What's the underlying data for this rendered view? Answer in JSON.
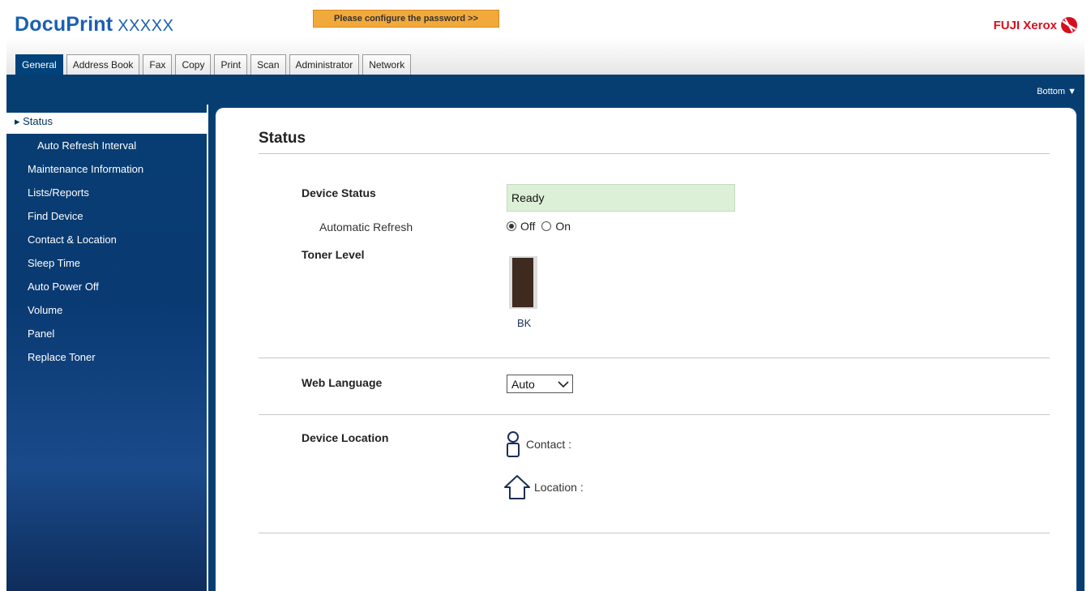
{
  "header": {
    "logo_main": "DocuPrint",
    "logo_model": "XXXXX",
    "password_button": "Please configure the password >>",
    "brand": "FUJI Xerox"
  },
  "tabs": [
    {
      "label": "General",
      "active": true
    },
    {
      "label": "Address Book"
    },
    {
      "label": "Fax"
    },
    {
      "label": "Copy"
    },
    {
      "label": "Print"
    },
    {
      "label": "Scan"
    },
    {
      "label": "Administrator"
    },
    {
      "label": "Network"
    }
  ],
  "bottom_link": "Bottom ▼",
  "sidebar": {
    "items": [
      {
        "label": "▸ Status"
      },
      {
        "label": "Auto Refresh Interval"
      },
      {
        "label": "Maintenance Information"
      },
      {
        "label": "Lists/Reports"
      },
      {
        "label": "Find Device"
      },
      {
        "label": "Contact & Location"
      },
      {
        "label": "Sleep Time"
      },
      {
        "label": "Auto Power Off"
      },
      {
        "label": "Volume"
      },
      {
        "label": "Panel"
      },
      {
        "label": "Replace Toner"
      }
    ]
  },
  "main": {
    "title": "Status",
    "device_status_label": "Device Status",
    "device_status_value": "Ready",
    "auto_refresh_label": "Automatic Refresh",
    "auto_refresh_off": "Off",
    "auto_refresh_on": "On",
    "auto_refresh_selected": "Off",
    "toner_level_label": "Toner Level",
    "toner_name": "BK",
    "toner_level_fraction": 1.0,
    "toner_color": "#3f2a20",
    "web_language_label": "Web Language",
    "web_language_value": "Auto",
    "device_location_label": "Device Location",
    "contact_label": "Contact :",
    "location_label": "Location :"
  },
  "colors": {
    "brand_blue": "#063e72",
    "status_ok": "#dcf0d8",
    "password_button": "#f2a93b",
    "brand_red": "#d40f20"
  }
}
